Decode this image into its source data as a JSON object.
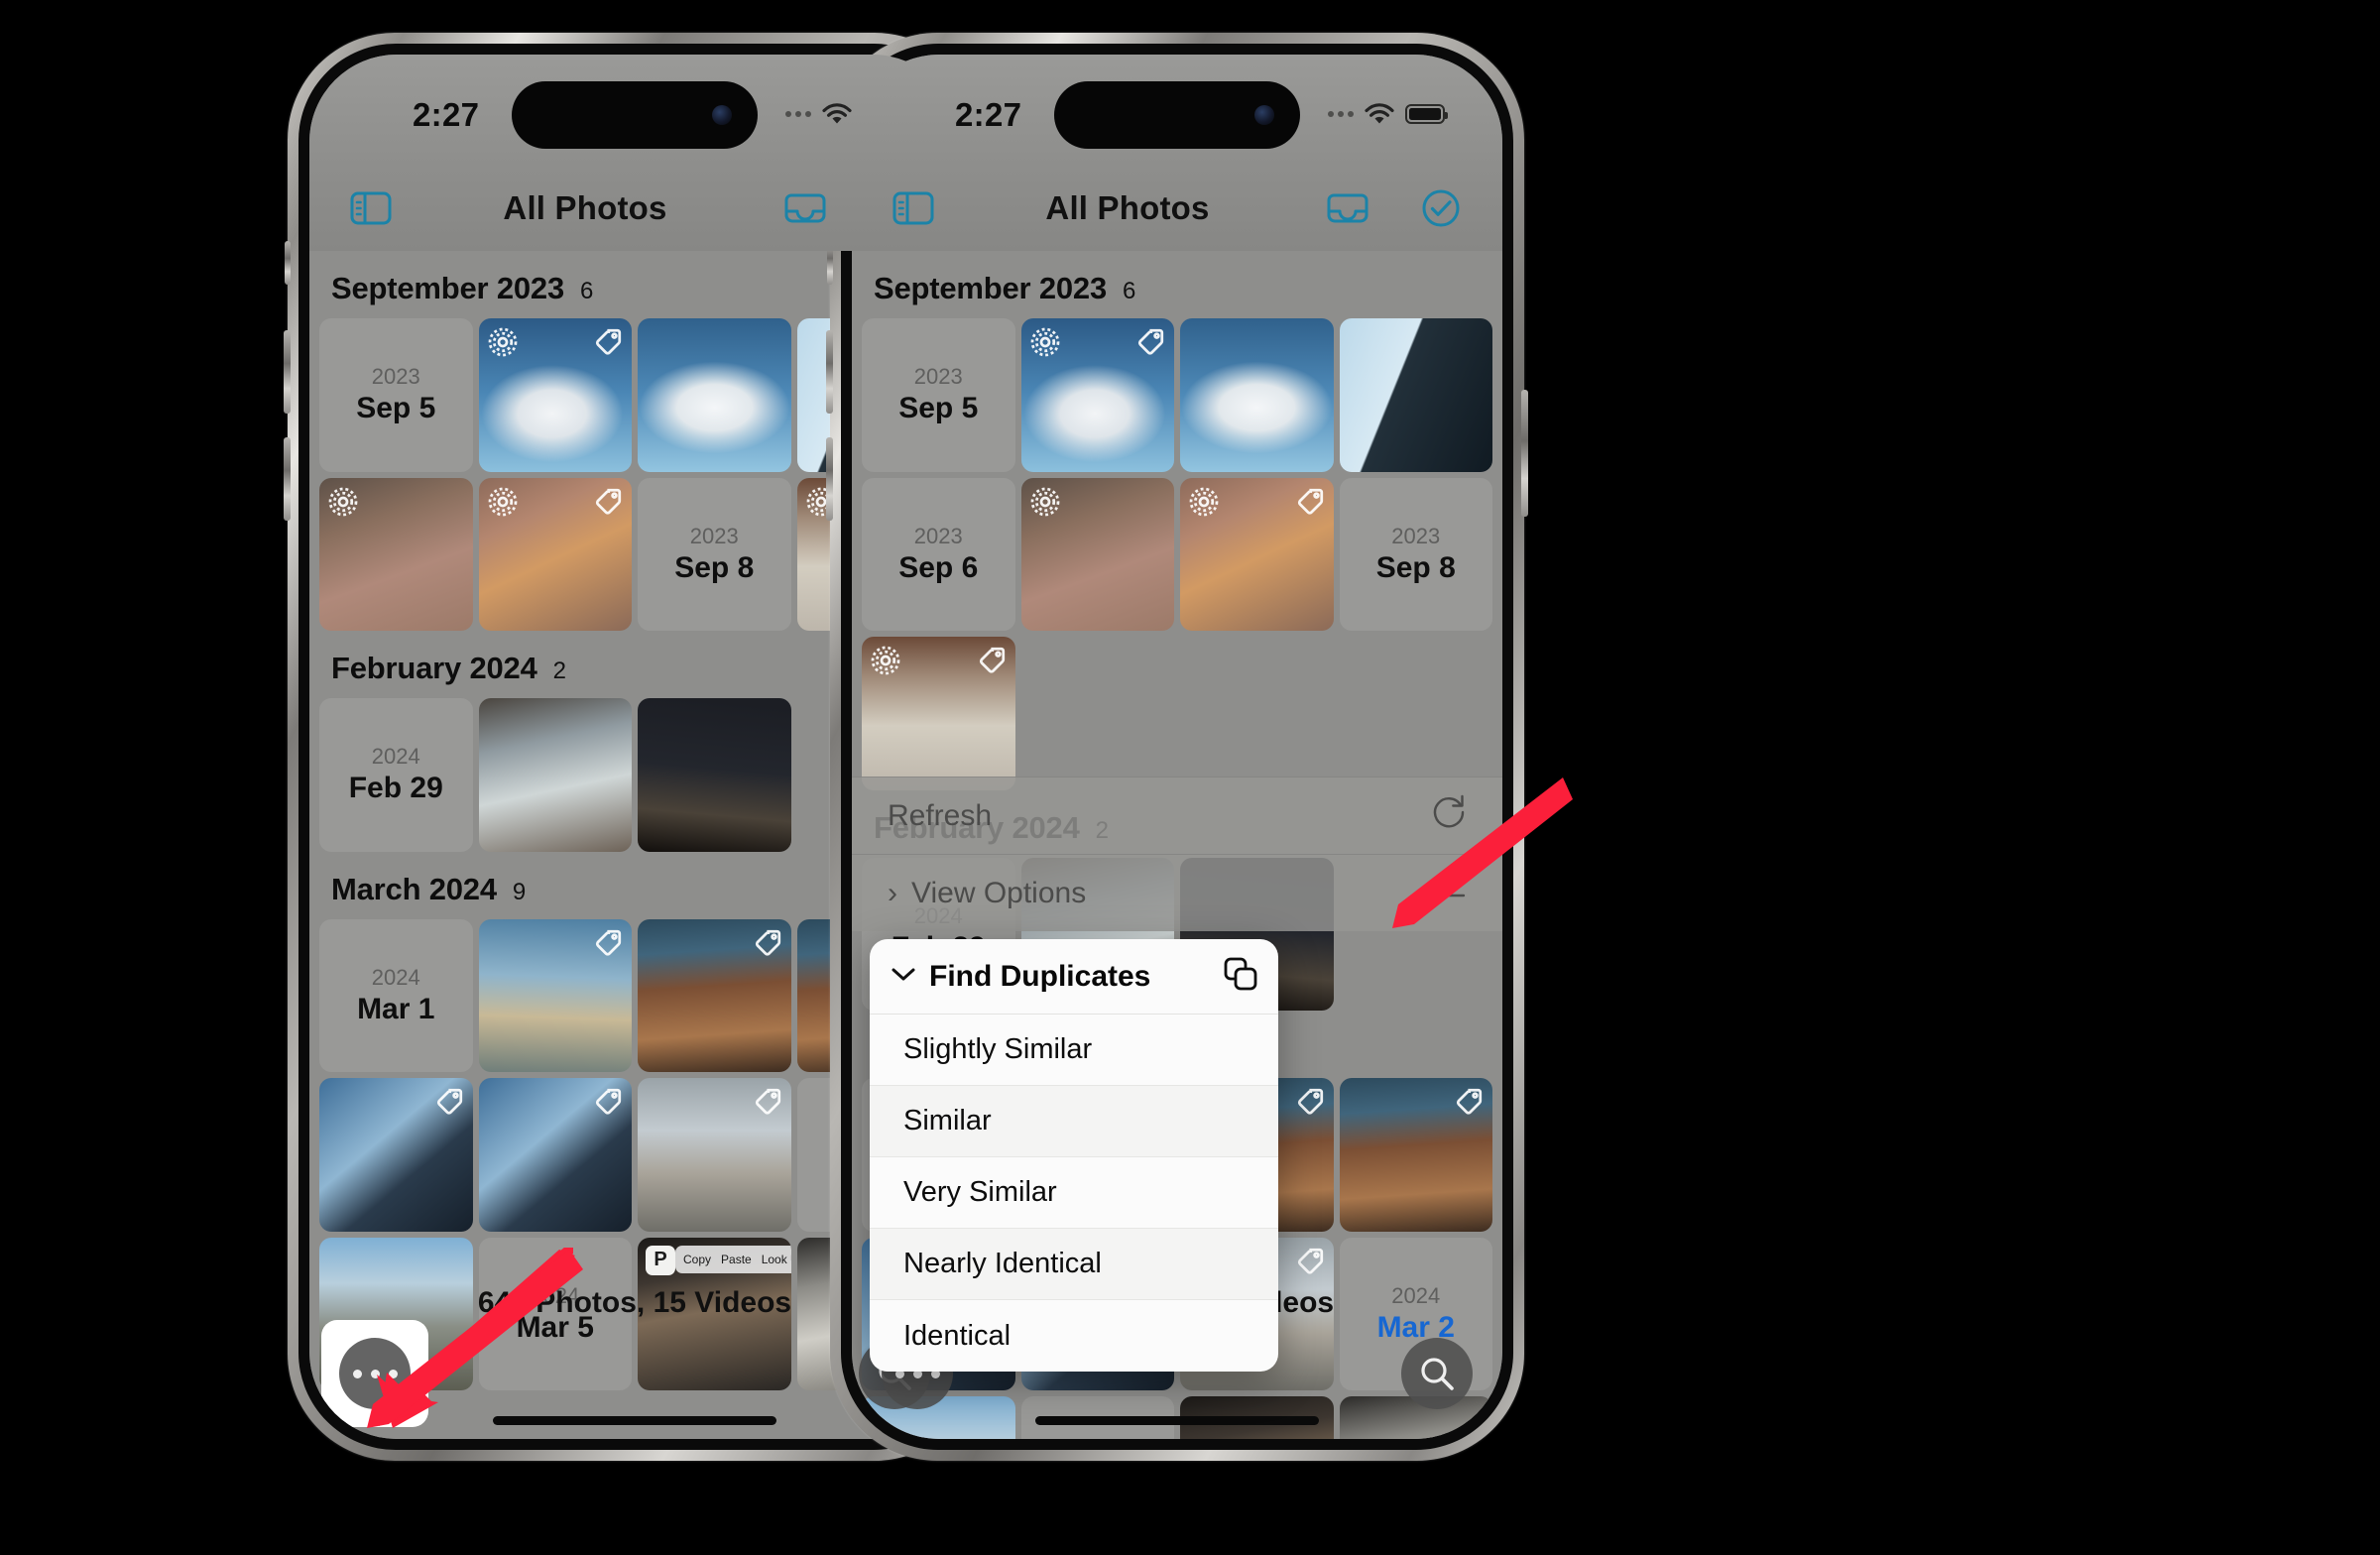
{
  "accent_colors": {
    "teal": "#1b83a8",
    "blue_highlight": "#1767d2",
    "arrow_red": "#fb1f3a",
    "screen_bg": "#8e8e8c"
  },
  "status_bar": {
    "time": "2:27",
    "signal_icon": "signal-dots-icon",
    "wifi_icon": "wifi-icon",
    "battery_icon": "battery-icon"
  },
  "nav_bar": {
    "sidebar_icon": "sidebar-toggle-icon",
    "title": "All Photos",
    "tray_icon": "tray-icon",
    "select_icon": "check-circle-icon"
  },
  "sections": [
    {
      "month": "September 2023",
      "count": "6",
      "cells": [
        {
          "kind": "date",
          "year": "2023",
          "day": "Sep 5",
          "highlight": false
        },
        {
          "kind": "photo",
          "art": "sky",
          "badges": [
            "live",
            "tag"
          ]
        },
        {
          "kind": "photo",
          "art": "sky2",
          "badges": []
        },
        {
          "kind": "photo",
          "art": "skybld",
          "badges": []
        },
        {
          "kind": "date",
          "year": "2023",
          "day": "Sep 6",
          "highlight": false
        },
        {
          "kind": "photo",
          "art": "cat",
          "badges": [
            "live"
          ]
        },
        {
          "kind": "photo",
          "art": "cat2",
          "badges": [
            "live",
            "tag"
          ]
        },
        {
          "kind": "date",
          "year": "2023",
          "day": "Sep 8",
          "highlight": false
        },
        {
          "kind": "photo",
          "art": "corridor",
          "badges": [
            "live",
            "tag"
          ]
        }
      ]
    },
    {
      "month": "February 2024",
      "count": "2",
      "cells": [
        {
          "kind": "date",
          "year": "2024",
          "day": "Feb 29",
          "highlight": false
        },
        {
          "kind": "photo",
          "art": "room",
          "badges": []
        },
        {
          "kind": "photo",
          "art": "night",
          "badges": []
        }
      ]
    },
    {
      "month": "March 2024",
      "count": "9",
      "cells": [
        {
          "kind": "date",
          "year": "2024",
          "day": "Mar 1",
          "highlight": false
        },
        {
          "kind": "photo",
          "art": "beach",
          "badges": [
            "tag"
          ]
        },
        {
          "kind": "photo",
          "art": "table",
          "badges": [
            "tag"
          ]
        },
        {
          "kind": "photo",
          "art": "table",
          "badges": [
            "tag"
          ]
        },
        {
          "kind": "photo",
          "art": "tower",
          "badges": [
            "tag"
          ]
        },
        {
          "kind": "photo",
          "art": "tower",
          "badges": [
            "tag"
          ]
        },
        {
          "kind": "photo",
          "art": "grey",
          "badges": [
            "tag"
          ]
        },
        {
          "kind": "date",
          "year": "2024",
          "day": "Mar 2",
          "highlight": true
        },
        {
          "kind": "photo",
          "art": "city",
          "badges": []
        },
        {
          "kind": "date",
          "year": "2024",
          "day": "Mar 5",
          "highlight": false
        },
        {
          "kind": "photo",
          "art": "catdark",
          "badges": [],
          "screenshot": true
        },
        {
          "kind": "photo",
          "art": "catwhite",
          "badges": [
            "tag"
          ]
        }
      ]
    }
  ],
  "screenshot_overlay": {
    "badge": "P",
    "context_menu": [
      "Copy",
      "Paste",
      "Look Up"
    ],
    "chevron": "›"
  },
  "footer": {
    "library_count": "644 Photos, 15 Videos",
    "more_button_icon": "more-ellipsis-icon",
    "search_button_icon": "search-icon"
  },
  "menu": {
    "rows": [
      {
        "label": "Refresh",
        "icon": "refresh-icon",
        "chevron": ""
      },
      {
        "label": "View Options",
        "icon": "sliders-icon",
        "chevron": "›"
      }
    ],
    "popup": {
      "title": "Find Duplicates",
      "expand_icon": "chevron-down-icon",
      "action_icon": "copy-duplicate-icon",
      "items": [
        "Slightly Similar",
        "Similar",
        "Very Similar",
        "Nearly Identical",
        "Identical"
      ]
    }
  },
  "annotations": {
    "left_arrow_target": "more-ellipsis-icon",
    "right_arrow_target": "find-duplicates-popup"
  }
}
